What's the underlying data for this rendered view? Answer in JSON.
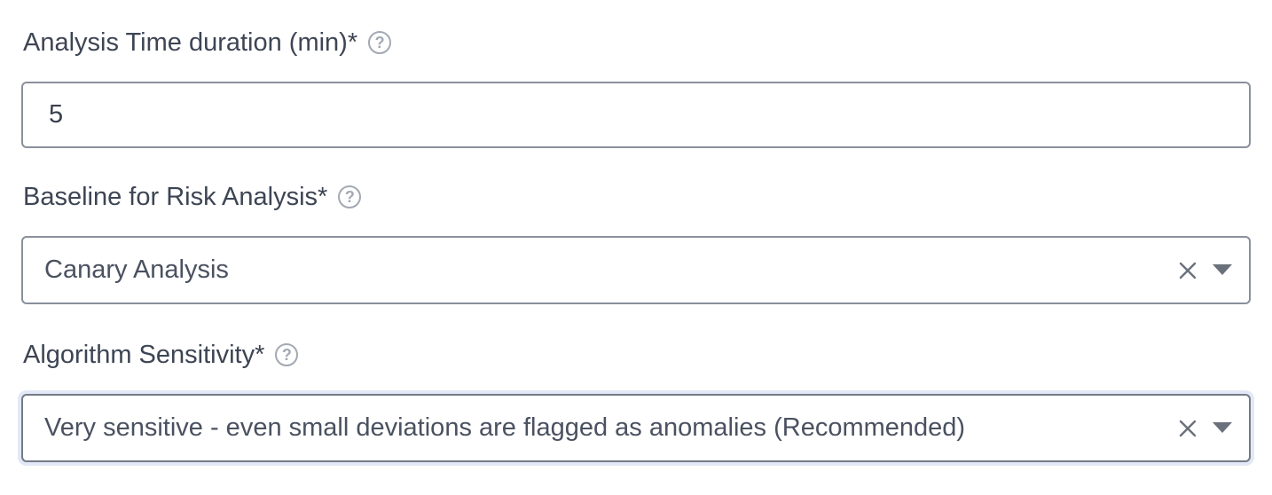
{
  "fields": {
    "analysis_duration": {
      "label": "Analysis Time duration (min)*",
      "help_icon": "question-circle-icon",
      "value": "5"
    },
    "baseline": {
      "label": "Baseline for Risk Analysis*",
      "help_icon": "question-circle-icon",
      "selected": "Canary Analysis",
      "clear_icon": "close-icon",
      "dropdown_icon": "caret-down-icon"
    },
    "sensitivity": {
      "label": "Algorithm Sensitivity*",
      "help_icon": "question-circle-icon",
      "selected": "Very sensitive - even small deviations are flagged as anomalies (Recommended)",
      "clear_icon": "close-icon",
      "dropdown_icon": "caret-down-icon"
    }
  },
  "colors": {
    "label_text": "#3d4554",
    "border": "#8a909c",
    "focus_ring": "#e3e8f6",
    "icon_gray": "#a3a9b3"
  }
}
